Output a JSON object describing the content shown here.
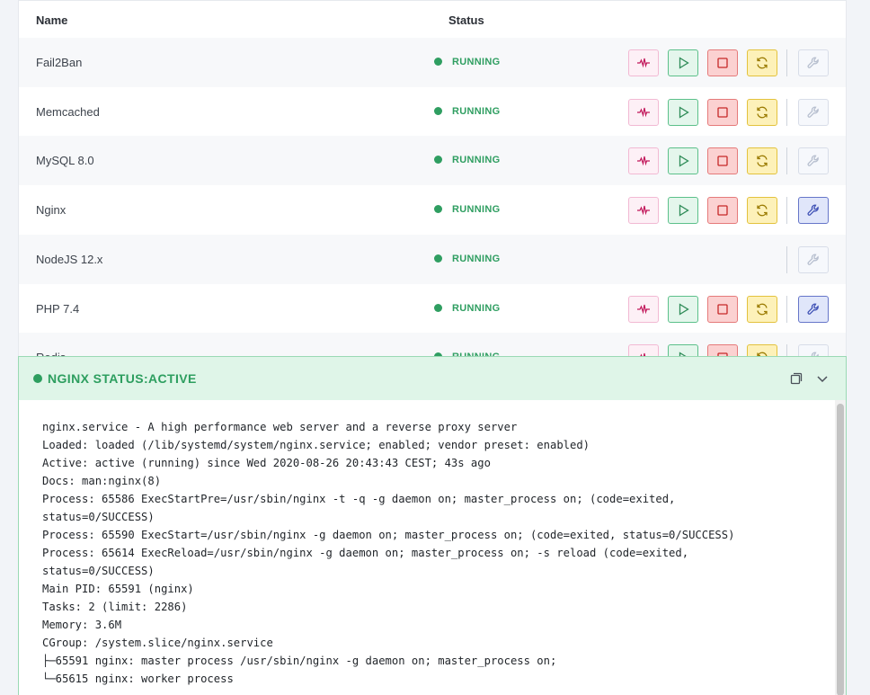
{
  "table": {
    "headers": {
      "name": "Name",
      "status": "Status"
    },
    "rows": [
      {
        "name": "Fail2Ban",
        "status": "RUNNING",
        "actions": true,
        "wrench_active": false
      },
      {
        "name": "Memcached",
        "status": "RUNNING",
        "actions": true,
        "wrench_active": false
      },
      {
        "name": "MySQL 8.0",
        "status": "RUNNING",
        "actions": true,
        "wrench_active": false
      },
      {
        "name": "Nginx",
        "status": "RUNNING",
        "actions": true,
        "wrench_active": true
      },
      {
        "name": "NodeJS 12.x",
        "status": "RUNNING",
        "actions": false,
        "wrench_active": false
      },
      {
        "name": "PHP 7.4",
        "status": "RUNNING",
        "actions": true,
        "wrench_active": true
      },
      {
        "name": "Redis",
        "status": "RUNNING",
        "actions": true,
        "wrench_active": false
      }
    ],
    "icons": {
      "pulse": "pulse-icon",
      "start": "play-icon",
      "stop": "stop-icon",
      "reload": "refresh-icon",
      "configure": "wrench-icon"
    }
  },
  "panel": {
    "title": "NGINX STATUS:ACTIVE",
    "icons": {
      "copy": "copy-icon",
      "collapse": "chevron-down-icon"
    },
    "lines": [
      "nginx.service - A high performance web server and a reverse proxy server",
      "Loaded: loaded (/lib/systemd/system/nginx.service; enabled; vendor preset: enabled)",
      "Active: active (running) since Wed 2020-08-26 20:43:43 CEST; 43s ago",
      "Docs: man:nginx(8)",
      "Process: 65586 ExecStartPre=/usr/sbin/nginx -t -q -g daemon on; master_process on; (code=exited,",
      "status=0/SUCCESS)",
      "Process: 65590 ExecStart=/usr/sbin/nginx -g daemon on; master_process on; (code=exited, status=0/SUCCESS)",
      "Process: 65614 ExecReload=/usr/sbin/nginx -g daemon on; master_process on; -s reload (code=exited,",
      "status=0/SUCCESS)",
      "Main PID: 65591 (nginx)",
      "Tasks: 2 (limit: 2286)",
      "Memory: 3.6M",
      "CGroup: /system.slice/nginx.service",
      "├─65591 nginx: master process /usr/sbin/nginx -g daemon on; master_process on;",
      "└─65615 nginx: worker process"
    ]
  },
  "colors": {
    "running": "#2f9e61",
    "panel_header_bg": "#dff5e8",
    "panel_border": "#9ad9b4"
  }
}
